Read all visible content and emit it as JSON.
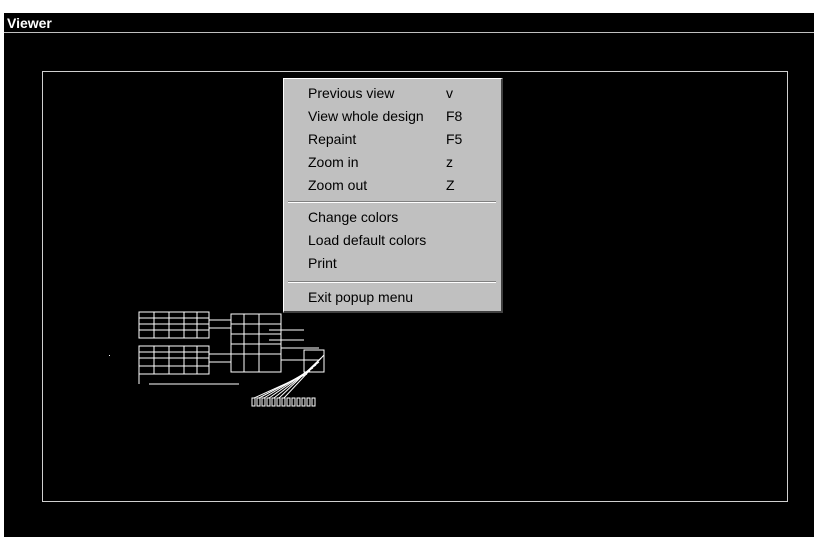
{
  "window": {
    "title": "Viewer"
  },
  "popup_menu": {
    "group1": [
      {
        "label": "Previous view",
        "shortcut": "v"
      },
      {
        "label": "View whole design",
        "shortcut": "F8"
      },
      {
        "label": "Repaint",
        "shortcut": "F5"
      },
      {
        "label": "Zoom in",
        "shortcut": "z"
      },
      {
        "label": "Zoom out",
        "shortcut": "Z"
      }
    ],
    "group2": [
      {
        "label": "Change colors"
      },
      {
        "label": "Load default colors"
      },
      {
        "label": "Print"
      }
    ],
    "group3": [
      {
        "label": "Exit popup menu"
      }
    ]
  },
  "colors": {
    "canvas_background": "#000000",
    "menu_background": "#c0c0c0",
    "design_lines": "#ffffff"
  }
}
